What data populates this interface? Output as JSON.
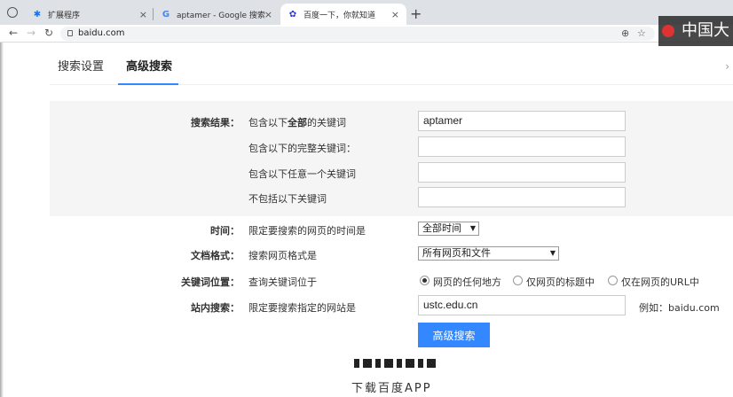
{
  "browser": {
    "tabs": [
      {
        "title": "扩展程序",
        "icon": "puzzle-icon"
      },
      {
        "title": "aptamer - Google 搜索",
        "icon": "google-g-icon"
      },
      {
        "title": "百度一下，你就知道",
        "icon": "baidu-paw-icon",
        "active": true
      }
    ],
    "url": "baidu.com",
    "overlay_text": "中国大学"
  },
  "settings_tabs": {
    "search_settings": "搜索设置",
    "advanced_search": "高级搜索"
  },
  "form": {
    "results_label": "搜索结果",
    "all_words_pre": "包含以下",
    "all_words_bold": "全部",
    "all_words_post": "的关键词",
    "all_words_value": "aptamer",
    "exact_phrase_label": "包含以下的完整关键词：",
    "any_words_label": "包含以下任意一个关键词",
    "exclude_words_label": "不包括以下关键词",
    "time_label": "时间",
    "time_desc": "限定要搜索的网页的时间是",
    "time_value": "全部时间",
    "format_label": "文档格式",
    "format_desc": "搜索网页格式是",
    "format_value": "所有网页和文件",
    "position_label": "关键词位置",
    "position_desc": "查询关键词位于",
    "position_options": [
      "网页的任何地方",
      "仅网页的标题中",
      "仅在网页的URL中"
    ],
    "site_label": "站内搜索",
    "site_desc": "限定要搜索指定的网站是",
    "site_value": "ustc.edu.cn",
    "site_example": "例如：baidu.com",
    "submit_label": "高级搜索"
  },
  "footer": {
    "download_app": "下载百度APP"
  },
  "colors": {
    "accent": "#3388ff",
    "form_bg": "#f5f5f6"
  }
}
